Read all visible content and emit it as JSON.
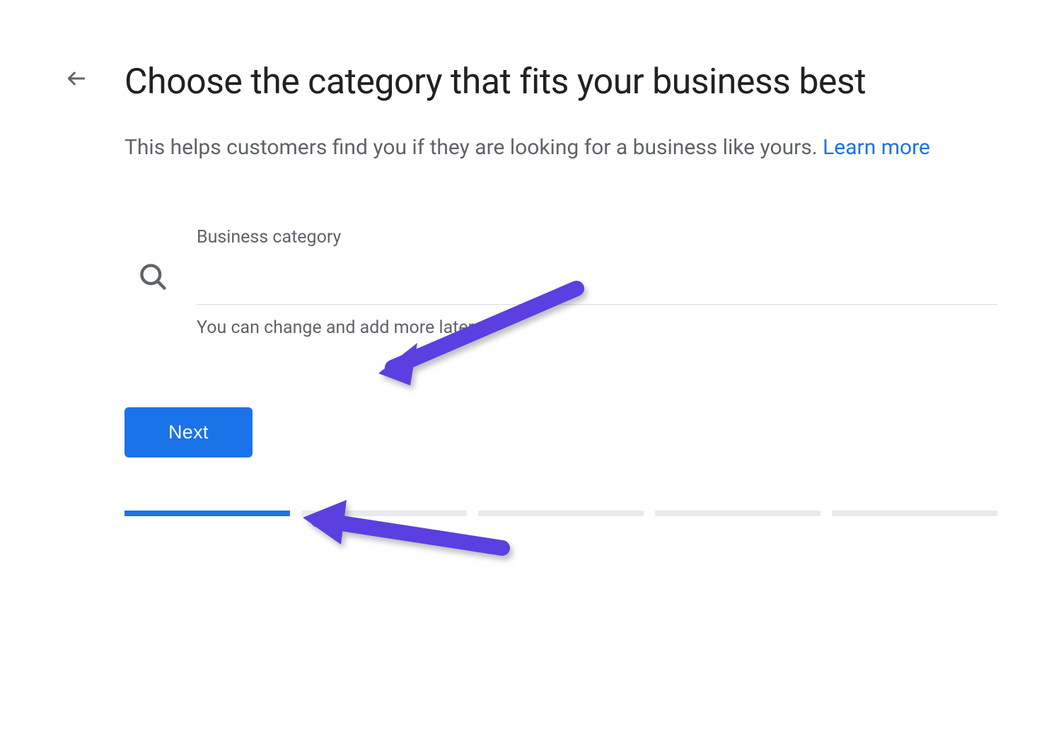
{
  "header": {
    "back_aria": "Back",
    "title": "Choose the category that fits your business best"
  },
  "subtitle": {
    "text": "This helps customers find you if they are looking for a business like yours. ",
    "learn_more": "Learn more"
  },
  "form": {
    "label": "Business category",
    "value": "",
    "helper": "You can change and add more later"
  },
  "actions": {
    "next": "Next"
  },
  "progress": {
    "total": 5,
    "current": 1
  },
  "colors": {
    "primary": "#1a73e8",
    "text_primary": "#202124",
    "text_secondary": "#5f6368",
    "divider": "#dadce0",
    "progress_bg": "#e8eaed",
    "annotation_arrow": "#5b3fe0"
  },
  "annotations": {
    "arrow_to_input": true,
    "arrow_to_next": true
  }
}
